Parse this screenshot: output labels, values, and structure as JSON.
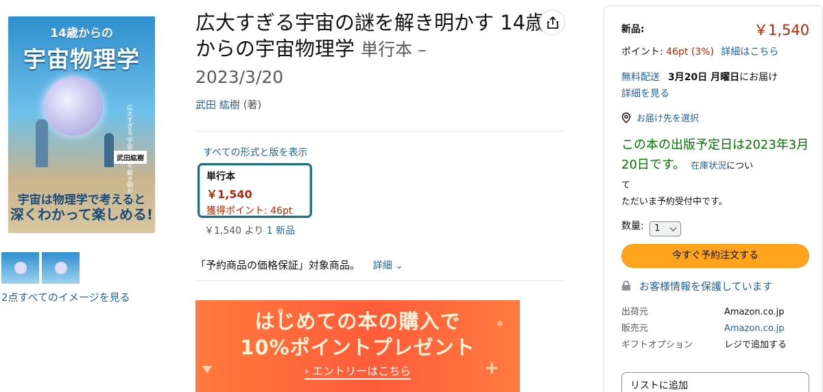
{
  "cover": {
    "top": "14歳からの",
    "title": "宇宙物理学",
    "side_text": "広大すぎる 宇宙の謎を 解き明かす",
    "author": "武田紘樹",
    "band_line1": "宇宙は物理学で考えると",
    "band_line2": "深くわかって楽しめる!"
  },
  "see_all_images": "2点すべてのイメージを見る",
  "product": {
    "title": "広大すぎる宇宙の謎を解き明かす 14歳からの宇宙物理学",
    "binding": "単行本 –",
    "date": "2023/3/20",
    "author": "武田 紘樹",
    "author_role": "(著)",
    "formats_link": "すべての形式と版を表示",
    "format_label": "単行本",
    "format_price": "￥1,540",
    "format_points": "獲得ポイント: 46pt",
    "from_price": "￥1,540",
    "from_mid": "より",
    "from_new": "1 新品",
    "guarantee": "「予約商品の価格保証」対象商品。",
    "details": "詳細 ⌄"
  },
  "banner": {
    "line1": "はじめての本の購入で",
    "line2": "10%ポイントプレゼント",
    "cta": "› エントリーはこちら"
  },
  "buybox": {
    "new_label": "新品:",
    "price": "￥1,540",
    "points_label": "ポイント:",
    "points_value": "46pt",
    "points_pct": "(3%)",
    "points_link": "詳細はこちら",
    "shipping_link": "無料配送",
    "delivery_date": "3月20日 月曜日",
    "delivery_suffix": "にお届け",
    "details_link": "詳細を見る",
    "deliver_to": "お届け先を選択",
    "availability": "この本の出版予定日は2023年3月20日です。",
    "stock_link": "在庫状況",
    "stock_suffix": "につい",
    "availability2_line1": "て",
    "availability2_line2": "ただいま予約受付中です。",
    "qty_label": "数量:",
    "qty_value": "1",
    "preorder_button": "今すぐ予約注文する",
    "secure": "お客様情報を保護しています",
    "info_rows": [
      {
        "k": "出荷元",
        "v": "Amazon.co.jp"
      },
      {
        "k": "販売元",
        "v": "Amazon.co.jp"
      },
      {
        "k": "ギフトオプション",
        "v": "レジで追加する"
      }
    ],
    "add_list": "リストに追加"
  },
  "colors": {
    "price_red": "#b12704",
    "link_blue": "#2162a1",
    "avail_green": "#007600",
    "button_orange": "#ffa41c",
    "format_border": "#1f6f82"
  }
}
